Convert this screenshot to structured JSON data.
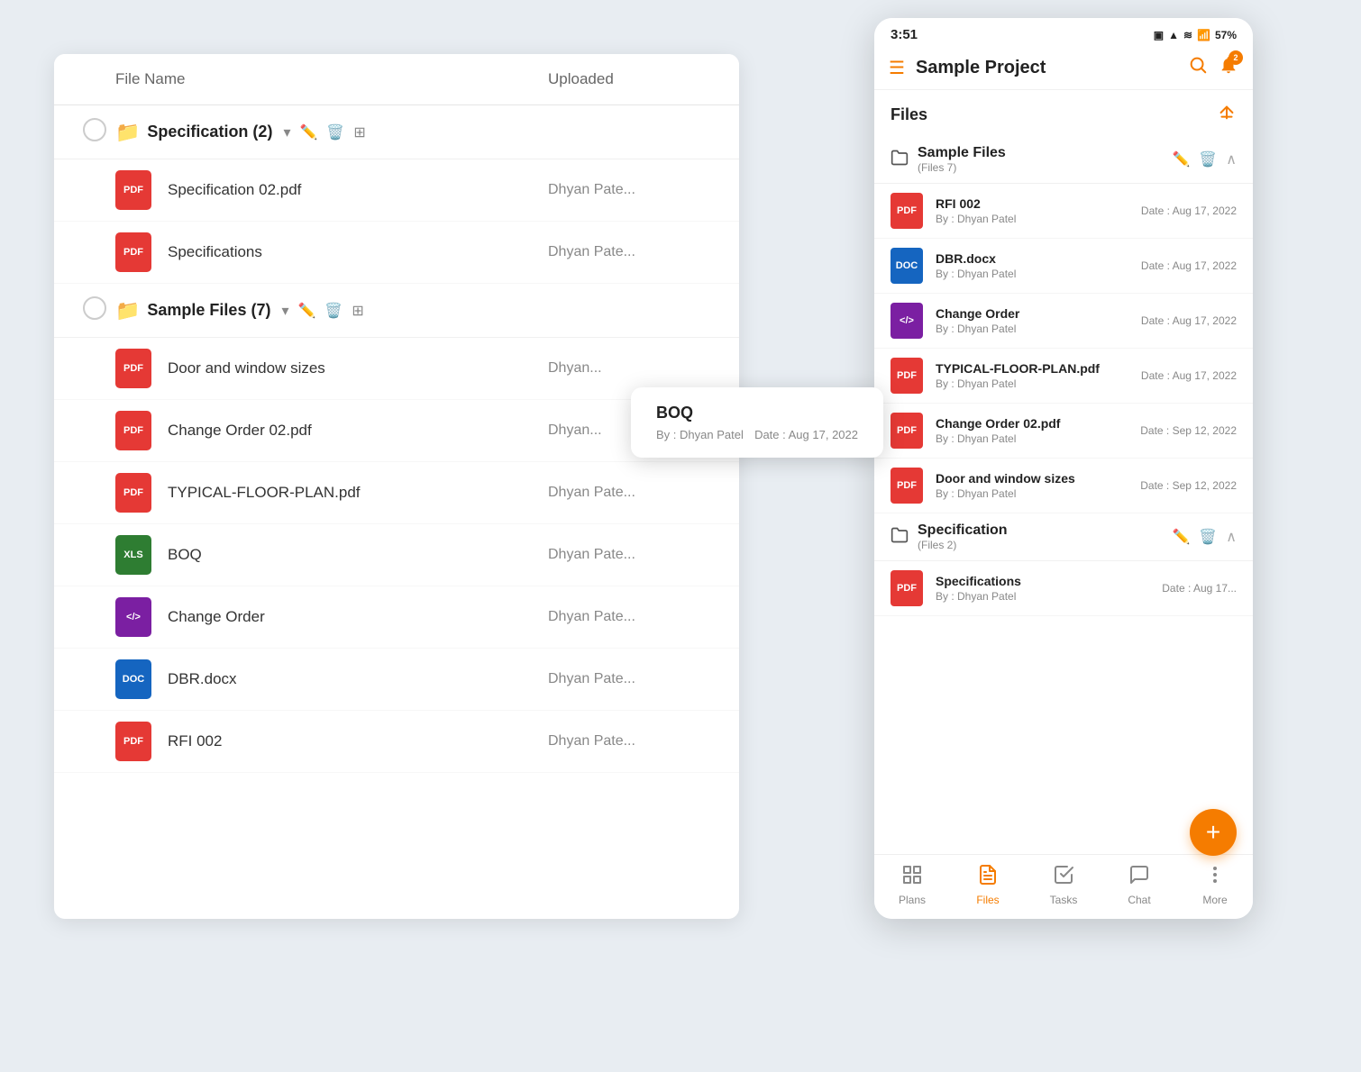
{
  "desktop": {
    "table_header": {
      "filename": "File Name",
      "uploaded": "Uploaded"
    },
    "folders": [
      {
        "name": "Specification",
        "count": 2,
        "files": [
          {
            "name": "Specification 02.pdf",
            "uploaded": "Dhyan Pate",
            "type": "pdf"
          },
          {
            "name": "Specifications",
            "uploaded": "Dhyan Pate",
            "type": "pdf"
          }
        ]
      },
      {
        "name": "Sample Files",
        "count": 7,
        "files": [
          {
            "name": "Door and window sizes",
            "uploaded": "Dhyan",
            "type": "pdf"
          },
          {
            "name": "Change Order 02.pdf",
            "uploaded": "Dhyan",
            "type": "pdf"
          },
          {
            "name": "TYPICAL-FLOOR-PLAN.pdf",
            "uploaded": "Dhyan Pate",
            "type": "pdf"
          },
          {
            "name": "BOQ",
            "uploaded": "Dhyan Pate",
            "type": "xlsx"
          },
          {
            "name": "Change Order",
            "uploaded": "Dhyan Pate",
            "type": "code"
          },
          {
            "name": "DBR.docx",
            "uploaded": "Dhyan Pate",
            "type": "docx"
          },
          {
            "name": "RFI 002",
            "uploaded": "Dhyan Pate",
            "type": "pdf"
          }
        ]
      }
    ]
  },
  "mobile": {
    "status_bar": {
      "time": "3:51",
      "battery": "57%"
    },
    "header": {
      "title": "Sample Project",
      "notifications": 2
    },
    "files_section": {
      "title": "Files"
    },
    "folders": [
      {
        "id": "sample-files",
        "name": "Sample Files",
        "count_label": "(Files 7)",
        "files": [
          {
            "name": "RFI 002",
            "by": "By : Dhyan Patel",
            "date": "Date : Aug 17, 2022",
            "type": "pdf"
          },
          {
            "name": "DBR.docx",
            "by": "By : Dhyan Patel",
            "date": "Date : Aug 17, 2022",
            "type": "docx"
          },
          {
            "name": "Change Order",
            "by": "By : Dhyan Patel",
            "date": "Date : Aug 17, 2022",
            "type": "code"
          },
          {
            "name": "TYPICAL-FLOOR-PLAN.pdf",
            "by": "By : Dhyan Patel",
            "date": "Date : Aug 17, 2022",
            "type": "pdf"
          },
          {
            "name": "Change Order 02.pdf",
            "by": "By : Dhyan Patel",
            "date": "Date : Sep 12, 2022",
            "type": "pdf"
          },
          {
            "name": "Door and window sizes",
            "by": "By : Dhyan Patel",
            "date": "Date : Sep 12, 2022",
            "type": "pdf"
          }
        ]
      },
      {
        "id": "specification",
        "name": "Specification",
        "count_label": "(Files 2)",
        "files": [
          {
            "name": "Specifications",
            "by": "By : Dhyan Patel",
            "date": "Date : Aug 17",
            "type": "pdf"
          }
        ]
      }
    ],
    "boq_tooltip": {
      "title": "BOQ",
      "by": "By : Dhyan Patel",
      "date": "Date : Aug 17, 2022"
    },
    "bottom_nav": [
      {
        "label": "Plans",
        "icon": "plans",
        "active": false
      },
      {
        "label": "Files",
        "icon": "files",
        "active": true
      },
      {
        "label": "Tasks",
        "icon": "tasks",
        "active": false
      },
      {
        "label": "Chat",
        "icon": "chat",
        "active": false
      },
      {
        "label": "More",
        "icon": "more",
        "active": false
      }
    ],
    "fab_label": "+"
  }
}
